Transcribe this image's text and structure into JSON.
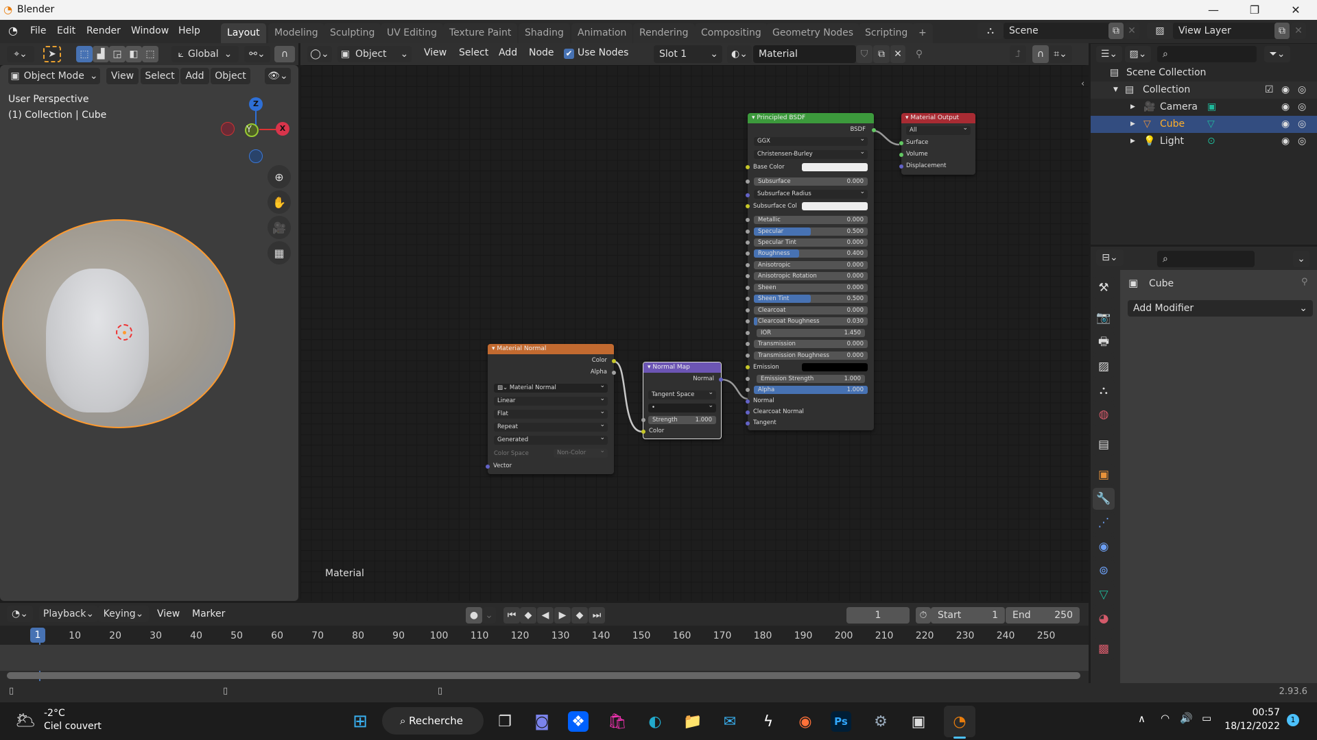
{
  "window": {
    "title": "Blender",
    "minimize": "—",
    "maximize": "❐",
    "close": "✕"
  },
  "menubar": {
    "items": [
      "File",
      "Edit",
      "Render",
      "Window",
      "Help"
    ]
  },
  "workspaces": {
    "tabs": [
      "Layout",
      "Modeling",
      "Sculpting",
      "UV Editing",
      "Texture Paint",
      "Shading",
      "Animation",
      "Rendering",
      "Compositing",
      "Geometry Nodes",
      "Scripting"
    ],
    "active": "Layout",
    "add": "+"
  },
  "scene": {
    "label": "Scene",
    "view_layer": "View Layer"
  },
  "viewport": {
    "toolbar": {
      "transform_orientation": "Global"
    },
    "header": {
      "mode": "Object Mode",
      "menus": [
        "View",
        "Select",
        "Add",
        "Object"
      ]
    },
    "overlay_text": {
      "view": "User Perspective",
      "context": "(1) Collection | Cube"
    },
    "gizmo": {
      "x": "X",
      "y": "Y",
      "z": "Z"
    }
  },
  "node_editor": {
    "header": {
      "type": "Object",
      "menus": [
        "View",
        "Select",
        "Add",
        "Node"
      ],
      "use_nodes_label": "Use Nodes",
      "use_nodes": true,
      "slot": "Slot 1",
      "material": "Material"
    },
    "footer_label": "Material",
    "nodes": {
      "principled": {
        "title": "Principled BSDF",
        "output": "BSDF",
        "distribution": "GGX",
        "subsurface_method": "Christensen-Burley",
        "base_color": "Base Color",
        "subsurface_radius": "Subsurface Radius",
        "subsurface_col": "Subsurface Col",
        "emission": "Emission",
        "params": [
          {
            "label": "Subsurface",
            "value": "0.000",
            "fill": 0
          },
          {
            "label": "Metallic",
            "value": "0.000",
            "fill": 0
          },
          {
            "label": "Specular",
            "value": "0.500",
            "fill": 0.5
          },
          {
            "label": "Specular Tint",
            "value": "0.000",
            "fill": 0
          },
          {
            "label": "Roughness",
            "value": "0.400",
            "fill": 0.4
          },
          {
            "label": "Anisotropic",
            "value": "0.000",
            "fill": 0
          },
          {
            "label": "Anisotropic Rotation",
            "value": "0.000",
            "fill": 0
          },
          {
            "label": "Sheen",
            "value": "0.000",
            "fill": 0
          },
          {
            "label": "Sheen Tint",
            "value": "0.500",
            "fill": 0.5
          },
          {
            "label": "Clearcoat",
            "value": "0.000",
            "fill": 0
          },
          {
            "label": "Clearcoat Roughness",
            "value": "0.030",
            "fill": 0.03
          },
          {
            "label": "IOR",
            "value": "1.450",
            "fill": 0
          },
          {
            "label": "Transmission",
            "value": "0.000",
            "fill": 0
          },
          {
            "label": "Transmission Roughness",
            "value": "0.000",
            "fill": 0
          }
        ],
        "emission_strength": {
          "label": "Emission Strength",
          "value": "1.000"
        },
        "alpha": {
          "label": "Alpha",
          "value": "1.000",
          "fill": 1
        },
        "inputs_bottom": [
          "Normal",
          "Clearcoat Normal",
          "Tangent"
        ]
      },
      "output": {
        "title": "Material Output",
        "target": "All",
        "inputs": [
          "Surface",
          "Volume",
          "Displacement"
        ]
      },
      "image": {
        "title": "Material Normal",
        "outputs": [
          "Color",
          "Alpha"
        ],
        "image_name": "Material Normal",
        "interpolation": "Linear",
        "projection": "Flat",
        "extension": "Repeat",
        "source": "Generated",
        "color_space_label": "Color Space",
        "color_space": "Non-Color",
        "input": "Vector"
      },
      "normal_map": {
        "title": "Normal Map",
        "output": "Normal",
        "space": "Tangent Space",
        "uv": "•",
        "strength_label": "Strength",
        "strength": "1.000",
        "input": "Color"
      }
    }
  },
  "outliner": {
    "root": "Scene Collection",
    "items": [
      {
        "name": "Collection",
        "level": 0
      },
      {
        "name": "Camera",
        "level": 1
      },
      {
        "name": "Cube",
        "level": 1,
        "selected": true
      },
      {
        "name": "Light",
        "level": 1
      }
    ]
  },
  "properties": {
    "object_name": "Cube",
    "add_modifier": "Add Modifier"
  },
  "timeline": {
    "menus": [
      "Playback",
      "Keying",
      "View",
      "Marker"
    ],
    "current_frame": "1",
    "start_label": "Start",
    "start": "1",
    "end_label": "End",
    "end": "250",
    "ticks": [
      "10",
      "20",
      "30",
      "40",
      "50",
      "60",
      "70",
      "80",
      "90",
      "100",
      "110",
      "120",
      "130",
      "140",
      "150",
      "160",
      "170",
      "180",
      "190",
      "200",
      "210",
      "220",
      "230",
      "240",
      "250"
    ]
  },
  "statusbar": {
    "version": "2.93.6"
  },
  "taskbar": {
    "weather_temp": "-2°C",
    "weather_desc": "Ciel couvert",
    "search": "Recherche",
    "time": "00:57",
    "date": "18/12/2022",
    "notifications": "1"
  },
  "colors": {
    "accent": "#4772b3",
    "selection": "#ffa238",
    "principled_header": "#3c9a3c",
    "output_header": "#a82b33",
    "texture_header": "#c26a30",
    "vector_header": "#6c55b4"
  }
}
